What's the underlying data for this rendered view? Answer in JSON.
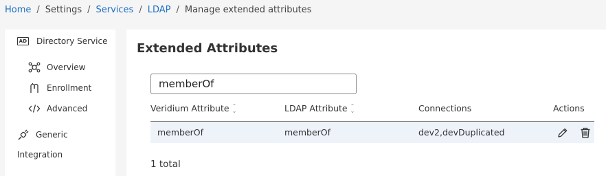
{
  "breadcrumb": {
    "home": "Home",
    "settings": "Settings",
    "services": "Services",
    "ldap": "LDAP",
    "current": "Manage extended attributes",
    "separator": "/"
  },
  "sidebar": {
    "directory_service": "Directory Service",
    "ad_badge": "AD",
    "items": [
      {
        "label": "Overview",
        "icon": "overview-icon"
      },
      {
        "label": "Enrollment",
        "icon": "enrollment-icon"
      },
      {
        "label": "Advanced",
        "icon": "code-icon"
      }
    ],
    "generic": "Generic",
    "integration": "Integration"
  },
  "main": {
    "title": "Extended Attributes",
    "search_value": "memberOf",
    "table": {
      "columns": [
        "Veridium Attribute",
        "LDAP Attribute",
        "Connections",
        "Actions"
      ],
      "rows": [
        {
          "veridium": "memberOf",
          "ldap": "memberOf",
          "connections": "dev2,devDuplicated"
        }
      ]
    },
    "total": "1 total"
  },
  "colors": {
    "link": "#1d6fc1",
    "row_highlight": "#eef3fa",
    "background": "#f5f5f5"
  }
}
